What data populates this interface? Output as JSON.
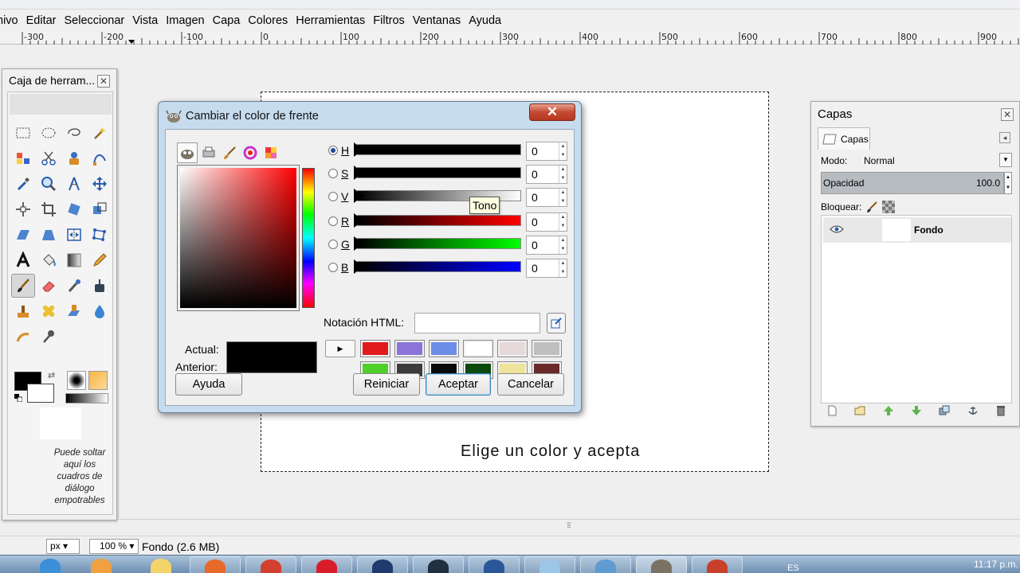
{
  "menubar": {
    "items": [
      "nivo",
      "Editar",
      "Seleccionar",
      "Vista",
      "Imagen",
      "Capa",
      "Colores",
      "Herramientas",
      "Filtros",
      "Ventanas",
      "Ayuda"
    ]
  },
  "ruler": {
    "labels": [
      "-300",
      "-200",
      "-100",
      "0",
      "100",
      "200",
      "300",
      "400",
      "500",
      "600",
      "700",
      "800",
      "900"
    ]
  },
  "canvas": {
    "text": "Elige  un color y acepta"
  },
  "toolbox": {
    "title": "Caja de herram...",
    "drop_hint": "Puede soltar aquí los cuadros de diálogo empotrables"
  },
  "dialog": {
    "title": "Cambiar el color de frente",
    "close_symbol": "✕",
    "sliders": [
      {
        "label": "H",
        "value": "0",
        "selected": true
      },
      {
        "label": "S",
        "value": "0",
        "selected": false
      },
      {
        "label": "V",
        "value": "0",
        "selected": false
      },
      {
        "label": "R",
        "value": "0",
        "selected": false
      },
      {
        "label": "G",
        "value": "0",
        "selected": false
      },
      {
        "label": "B",
        "value": "0",
        "selected": false
      }
    ],
    "tooltip": "Tono",
    "html_label": "Notación HTML:",
    "html_value": "",
    "actual_label": "Actual:",
    "previous_label": "Anterior:",
    "history_swatches": [
      "#e11b1b",
      "#8b74d9",
      "#6c8de6",
      "#ffffff",
      "#e5d9d9",
      "#bfbfbf",
      "#4fcf2a",
      "#3c3c3c",
      "#0a0a0a",
      "#0b4a0b",
      "#ede49a",
      "#6a2a2a"
    ],
    "buttons": {
      "help": "Ayuda",
      "reset": "Reiniciar",
      "accept": "Aceptar",
      "cancel": "Cancelar"
    }
  },
  "layers": {
    "title": "Capas",
    "tab_label": "Capas",
    "mode_label": "Modo:",
    "mode_value": "Normal",
    "opacity_label": "Opacidad",
    "opacity_value": "100.0",
    "lock_label": "Bloquear:",
    "layer_name": "Fondo"
  },
  "statusbar": {
    "unit": "px",
    "zoom": "100 %",
    "text": "Fondo (2.6 MB)"
  },
  "taskbar": {
    "lang": "ES",
    "clock": "11:17 p.m."
  }
}
